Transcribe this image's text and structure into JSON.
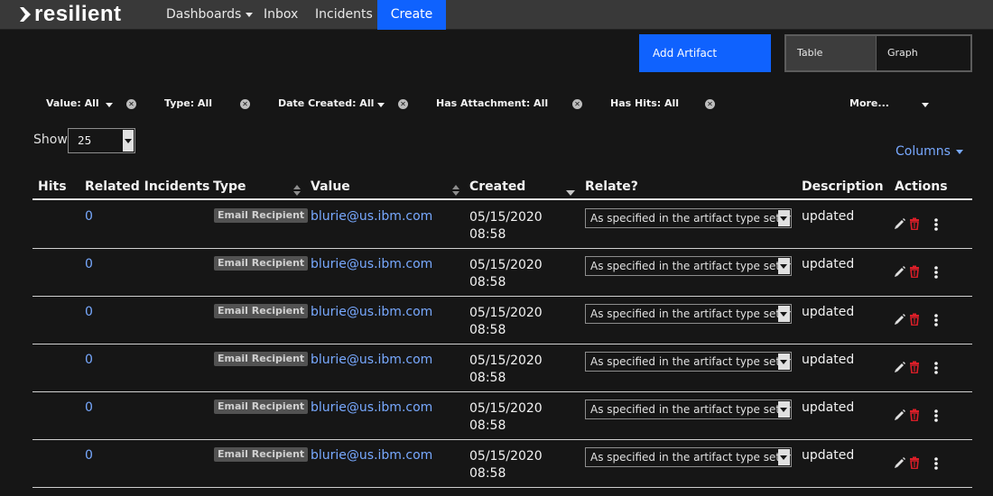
{
  "app": {
    "logo_text": "resilient"
  },
  "nav": {
    "items": [
      {
        "label": "Dashboards",
        "has_caret": true
      },
      {
        "label": "Inbox"
      },
      {
        "label": "Incidents"
      },
      {
        "label": "Create",
        "active": true
      }
    ]
  },
  "toolbar": {
    "add_artifact_label": "Add Artifact",
    "view_table_label": "Table",
    "view_graph_label": "Graph"
  },
  "filters": [
    {
      "label": "Value: All",
      "has_caret": true
    },
    {
      "label": "Type: All",
      "has_caret": false
    },
    {
      "label": "Date Created: All",
      "has_caret": true
    },
    {
      "label": "Has Attachment: All",
      "has_caret": false
    },
    {
      "label": "Has Hits: All",
      "has_caret": false
    },
    {
      "label": "More...",
      "has_caret": true
    }
  ],
  "pagination": {
    "show_label": "Show",
    "page_size": "25"
  },
  "columns_menu_label": "Columns",
  "table": {
    "headers": [
      "Hits",
      "Related Incidents",
      "Type",
      "Value",
      "Created",
      "Relate?",
      "Description",
      "Actions"
    ],
    "rows": [
      {
        "related_incidents": "0",
        "type": "Email Recipient",
        "value": "blurie@us.ibm.com",
        "created_date": "05/15/2020",
        "created_time": "08:58",
        "relate": "As specified in the artifact type settings",
        "description": "updated"
      },
      {
        "related_incidents": "0",
        "type": "Email Recipient",
        "value": "blurie@us.ibm.com",
        "created_date": "05/15/2020",
        "created_time": "08:58",
        "relate": "As specified in the artifact type settings",
        "description": "updated"
      },
      {
        "related_incidents": "0",
        "type": "Email Recipient",
        "value": "blurie@us.ibm.com",
        "created_date": "05/15/2020",
        "created_time": "08:58",
        "relate": "As specified in the artifact type settings",
        "description": "updated"
      },
      {
        "related_incidents": "0",
        "type": "Email Recipient",
        "value": "blurie@us.ibm.com",
        "created_date": "05/15/2020",
        "created_time": "08:58",
        "relate": "As specified in the artifact type settings",
        "description": "updated"
      },
      {
        "related_incidents": "0",
        "type": "Email Recipient",
        "value": "blurie@us.ibm.com",
        "created_date": "05/15/2020",
        "created_time": "08:58",
        "relate": "As specified in the artifact type settings",
        "description": "updated"
      },
      {
        "related_incidents": "0",
        "type": "Email Recipient",
        "value": "blurie@us.ibm.com",
        "created_date": "05/15/2020",
        "created_time": "08:58",
        "relate": "As specified in the artifact type settings",
        "description": "updated"
      }
    ]
  },
  "colors": {
    "accent": "#0f62fe",
    "link": "#78a9ff",
    "delete": "#da1e28"
  }
}
